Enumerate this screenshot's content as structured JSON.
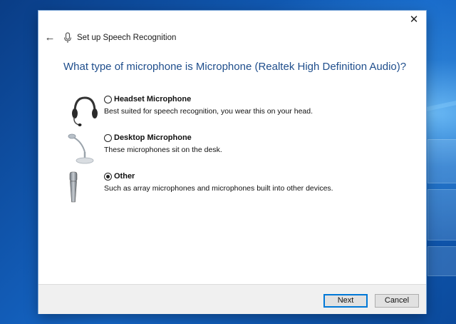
{
  "window": {
    "title": "Set up Speech Recognition",
    "close_glyph": "✕",
    "back_glyph": "←"
  },
  "question": "What type of microphone is Microphone (Realtek High Definition Audio)?",
  "options": [
    {
      "label": "Headset Microphone",
      "description": "Best suited for speech recognition, you wear this on your head.",
      "selected": false,
      "icon": "headset-icon"
    },
    {
      "label": "Desktop Microphone",
      "description": "These microphones sit on the desk.",
      "selected": false,
      "icon": "desktop-microphone-icon"
    },
    {
      "label": "Other",
      "description": "Such as array microphones and microphones built into other devices.",
      "selected": true,
      "icon": "handheld-microphone-icon"
    }
  ],
  "buttons": {
    "next": "Next",
    "cancel": "Cancel"
  },
  "colors": {
    "question_text": "#1f4e8c",
    "primary_button_border": "#0078d7",
    "desktop_background": "#0d4f9e"
  }
}
